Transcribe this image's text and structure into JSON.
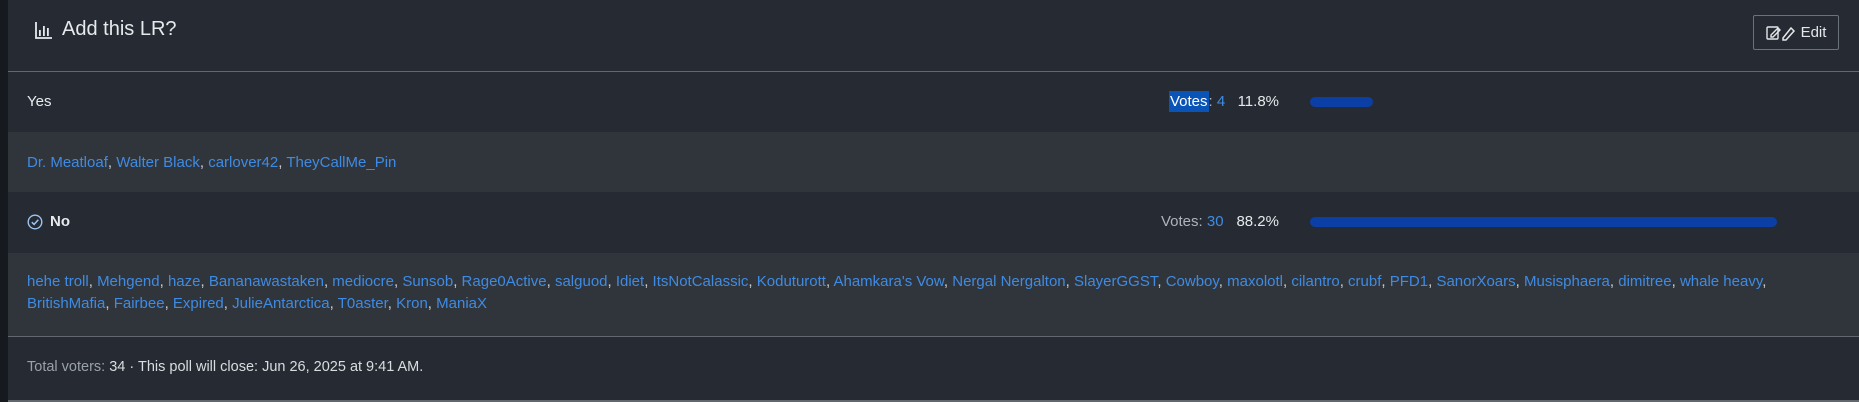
{
  "poll": {
    "title": "Add this LR?",
    "edit_label": "Edit",
    "votes_label": "Votes",
    "options": [
      {
        "label": "Yes",
        "votes": "4",
        "percent": "11.8%",
        "fraction": 0.118,
        "selected": false,
        "voters": [
          "Dr. Meatloaf",
          "Walter Black",
          "carlover42",
          "TheyCallMe_Pin"
        ]
      },
      {
        "label": "No",
        "votes": "30",
        "percent": "88.2%",
        "fraction": 0.882,
        "selected": true,
        "voters": [
          "hehe troll",
          "Mehgend",
          "haze",
          "Bananawastaken",
          "mediocre",
          "Sunsob",
          "Rage0Active",
          "salguod",
          "Idiet",
          "ItsNotCalassic",
          "Koduturott",
          "Ahamkara's Vow",
          "Nergal Nergalton",
          "SlayerGGST",
          "Cowboy",
          "maxolotl",
          "cilantro",
          "crubf",
          "PFD1",
          "SanorXoars",
          "Musisphaera",
          "dimitree",
          "whale heavy",
          "BritishMafia",
          "Fairbee",
          "Expired",
          "JulieAntarctica",
          "T0aster",
          "Kron",
          "ManiaX"
        ]
      }
    ],
    "footer": {
      "total_label": "Total voters:",
      "total": "34",
      "close_text": "· This poll will close: Jun 26, 2025 at 9:41 AM."
    }
  },
  "colors": {
    "background": "#262b33",
    "row_alt": "#30353c",
    "link": "#3f8be3",
    "bar": "#0b3fa5",
    "highlight": "#0a54b8"
  },
  "icons": {
    "title": "bar-chart-icon",
    "edit": "edit-icon",
    "selected": "check-circle-icon"
  }
}
